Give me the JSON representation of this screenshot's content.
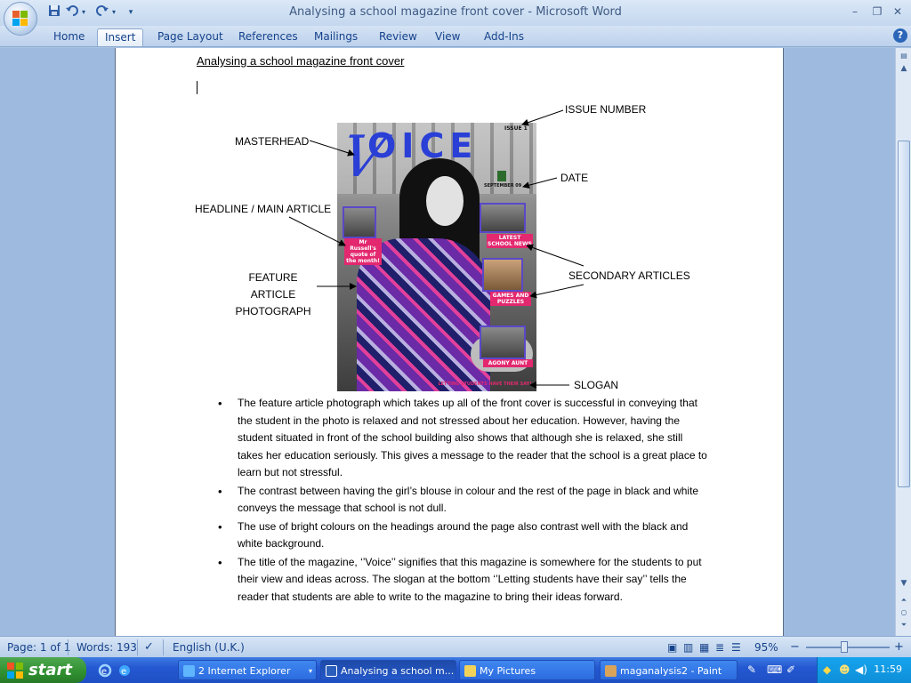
{
  "window": {
    "title": "Analysing a school magazine front cover - Microsoft Word",
    "minimize": "–",
    "restore": "❐",
    "close": "✕"
  },
  "quick_access": {
    "save_icon": "save-icon",
    "undo_icon": "undo-icon",
    "redo_icon": "redo-icon",
    "customize_icon": "dropdown-icon"
  },
  "ribbon": {
    "tabs": [
      {
        "label": "Home"
      },
      {
        "label": "Insert"
      },
      {
        "label": "Page Layout"
      },
      {
        "label": "References"
      },
      {
        "label": "Mailings"
      },
      {
        "label": "Review"
      },
      {
        "label": "View"
      },
      {
        "label": "Add-Ins"
      }
    ],
    "active_tab": "Insert",
    "help": "?"
  },
  "document": {
    "title": "Analysing a school magazine front cover",
    "labels": {
      "issue_number": "ISSUE NUMBER",
      "masterhead": "MASTERHEAD",
      "date": "DATE",
      "headline": "HEADLINE / MAIN ARTICLE",
      "secondary": "SECONDARY ARTICLES",
      "feature_line1": "FEATURE ARTICLE",
      "feature_line2": "PHOTOGRAPH",
      "slogan": "SLOGAN"
    },
    "cover": {
      "title": "OICE",
      "title_v": "V",
      "issue": "ISSUE 1",
      "date": "SEPTEMBER 09",
      "headline_box": "Mr Russell's quote of the month!",
      "box_news": "LATEST SCHOOL NEWS",
      "box_games": "GAMES AND PUZZLES",
      "box_agony": "AGONY AUNT",
      "slogan": "LETTING STUDENTS HAVE THEIR SAY!"
    },
    "bullets": [
      "The feature article photograph which takes up all of the front cover is successful in conveying that the student in the photo is relaxed and not stressed about her education. However, having the student situated in front of the school building  also shows that although she is relaxed, she still takes her education seriously. This gives a message to the reader that the school is a great place to learn but not stressful.",
      "The contrast between having the girl’s blouse in colour and the rest of the page in black and white conveys  the message that school is not dull.",
      "The use of bright colours on the headings around the page also contrast well with the black and white background.",
      "The title of the magazine, ‘’Voice’’ signifies that this magazine is somewhere for the students to put  their view and ideas across. The slogan at the bottom ‘’Letting students have their say’’ tells the reader that students are able to write to the magazine to bring their ideas forward."
    ]
  },
  "statusbar": {
    "page": "Page: 1 of 1",
    "words": "Words: 193",
    "language": "English (U.K.)",
    "zoom": "95%",
    "zoom_out": "−",
    "zoom_in": "+"
  },
  "taskbar": {
    "start": "start",
    "tasks": [
      {
        "label": "2 Internet Explorer"
      },
      {
        "label": "Analysing a school m..."
      },
      {
        "label": "My Pictures"
      },
      {
        "label": "maganalysis2 - Paint"
      }
    ],
    "clock": "11:59"
  },
  "colors": {
    "accent": "#15428b",
    "magazine_blue": "#2a3fd6",
    "magazine_pink": "#e3286f"
  }
}
